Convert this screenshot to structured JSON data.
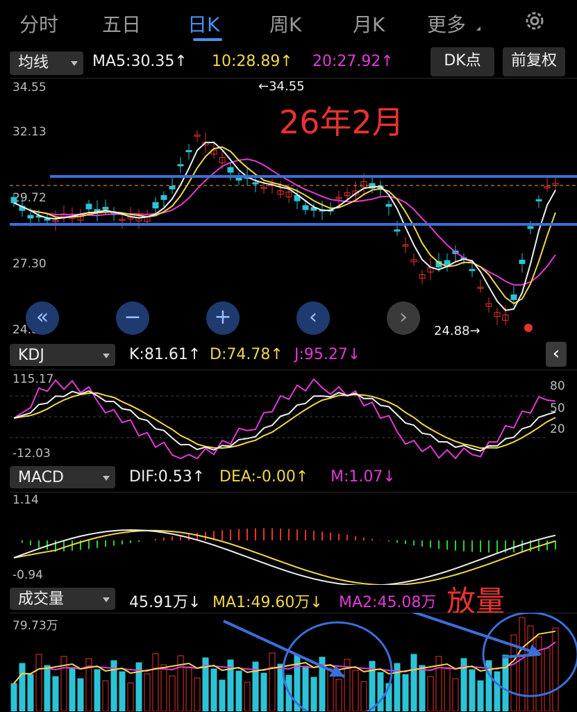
{
  "tabs": [
    {
      "label": "分时"
    },
    {
      "label": "五日"
    },
    {
      "label": "日K"
    },
    {
      "label": "周K"
    },
    {
      "label": "月K"
    },
    {
      "label": "更多"
    }
  ],
  "active_tab": "日K",
  "toolbar": {
    "ma_select": "均线",
    "ma5": "MA5:30.35↑",
    "ma10": "10:28.89↑",
    "ma20": "20:27.92↑",
    "dk_button": "DK点",
    "fq_button": "前复权"
  },
  "price_axis": [
    "34.55",
    "32.13",
    "29.72",
    "27.30",
    "24.88"
  ],
  "annotations": {
    "high_label": "←34.55",
    "low_label": "24.88→",
    "title_note": "26年2月",
    "volume_note": "放量"
  },
  "kdj": {
    "select": "KDJ",
    "k": "K:81.61↑",
    "d": "D:74.78↑",
    "j": "J:95.27↓",
    "axis_top": "115.17",
    "axis_bottom": "-12.03",
    "levels": [
      "80",
      "50",
      "20"
    ]
  },
  "macd": {
    "select": "MACD",
    "dif": "DIF:0.53↑",
    "dea": "DEA:-0.00↑",
    "m": "M:1.07↓",
    "axis_top": "1.14",
    "axis_bottom": "-0.94"
  },
  "volume": {
    "select": "成交量",
    "value": "45.91万↓",
    "ma1": "MA1:49.60万↓",
    "ma2": "MA2:45.08万",
    "axis_top": "79.73万"
  },
  "colors": {
    "up": "#e8322f",
    "down": "#2bc4d6",
    "ma5": "#f0f0f0",
    "ma10": "#f1d84a",
    "ma20": "#e23ad6",
    "accent": "#4a8ff0",
    "note": "#e8322f"
  }
}
